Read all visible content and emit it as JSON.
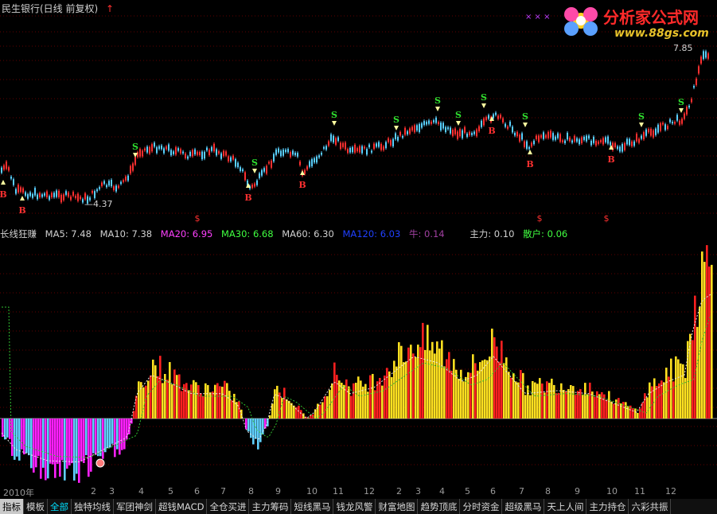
{
  "upper": {
    "title": "民生银行(日线 前复权)",
    "arrow": "↑",
    "price_high_label": "7.85",
    "price_low_label": "4.37",
    "markers": [
      "B",
      "S",
      "$"
    ]
  },
  "logo": {
    "name": "分析家公式网",
    "url": "www.88gs.com"
  },
  "indicator": {
    "name": "长线狂赚",
    "ma5": "MA5: 7.48",
    "ma10": "MA10: 7.38",
    "ma20": "MA20: 6.95",
    "ma30": "MA30: 6.68",
    "ma60": "MA60: 6.30",
    "ma120": "MA120: 6.03",
    "niu": "牛: 0.14",
    "zhuli": "主力: 0.10",
    "sanhu": "散户: 0.06"
  },
  "colors": {
    "ma5": "#d0d0d0",
    "ma10": "#d0d0d0",
    "ma20": "#ff40ff",
    "ma30": "#40ff40",
    "ma60": "#d0d0d0",
    "ma120": "#2040ff",
    "niu": "#a040a0",
    "zhuli": "#d0d0d0",
    "sanhu": "#40ff40",
    "up": "#ff2020",
    "down": "#60e0ff",
    "bar_yellow": "#ffe020",
    "bar_red": "#ff2020",
    "bar_magenta": "#ff20ff",
    "bar_cyan": "#60d0ff"
  },
  "x_axis": [
    "2010年",
    "2",
    "3",
    "4",
    "5",
    "6",
    "7",
    "8",
    "9",
    "10",
    "11",
    "12",
    "2",
    "3",
    "4",
    "5",
    "6",
    "7",
    "8",
    "9",
    "10",
    "11",
    "12"
  ],
  "tabs": [
    {
      "label": "指标",
      "state": "active"
    },
    {
      "label": "模板",
      "state": ""
    },
    {
      "label": "全部",
      "state": "sel"
    },
    {
      "label": "独特均线",
      "state": ""
    },
    {
      "label": "军团神剑",
      "state": ""
    },
    {
      "label": "超钱MACD",
      "state": ""
    },
    {
      "label": "全仓买进",
      "state": ""
    },
    {
      "label": "主力筹码",
      "state": ""
    },
    {
      "label": "短线黑马",
      "state": ""
    },
    {
      "label": "钱龙风警",
      "state": ""
    },
    {
      "label": "财富地图",
      "state": ""
    },
    {
      "label": "趋势顶底",
      "state": ""
    },
    {
      "label": "分时资金",
      "state": ""
    },
    {
      "label": "超级黑马",
      "state": ""
    },
    {
      "label": "天上人间",
      "state": ""
    },
    {
      "label": "主力持仓",
      "state": ""
    },
    {
      "label": "六彩共振",
      "state": ""
    }
  ]
}
